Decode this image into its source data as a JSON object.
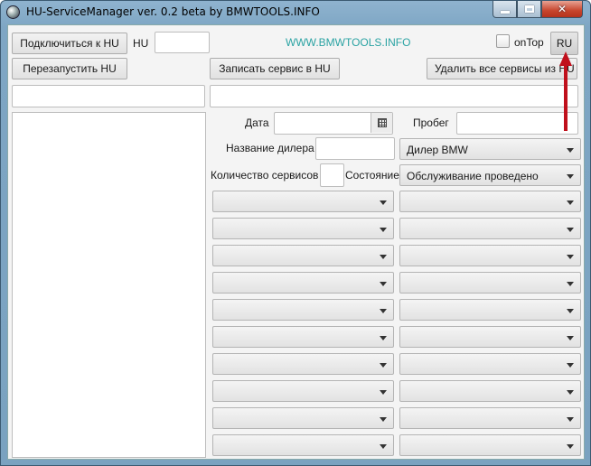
{
  "window": {
    "title": "HU-ServiceManager ver. 0.2 beta by BMWTOOLS.INFO"
  },
  "toolbar": {
    "connect_label": "Подключиться к HU",
    "hu_label": "HU",
    "hu_value": "",
    "site_link": "WWW.BMWTOOLS.INFO",
    "ontop_label": "onTop",
    "lang_label": "RU",
    "restart_label": "Перезапустить HU",
    "write_label": "Записать сервис в HU",
    "delete_label": "Удалить все сервисы из HU"
  },
  "form": {
    "date_label": "Дата",
    "date_value": "",
    "mileage_label": "Пробег",
    "mileage_value": "",
    "dealer_name_label": "Название дилера",
    "dealer_name_value": "",
    "dealer_select": "Дилер BMW",
    "count_label": "Количество сервисов",
    "count_value": "",
    "status_label": "Состояние",
    "status_select": "Обслуживание проведено"
  },
  "service_rows": [
    {
      "left": "",
      "right": ""
    },
    {
      "left": "",
      "right": ""
    },
    {
      "left": "",
      "right": ""
    },
    {
      "left": "",
      "right": ""
    },
    {
      "left": "",
      "right": ""
    },
    {
      "left": "",
      "right": ""
    },
    {
      "left": "",
      "right": ""
    },
    {
      "left": "",
      "right": ""
    },
    {
      "left": "",
      "right": ""
    },
    {
      "left": "",
      "right": ""
    }
  ],
  "colors": {
    "accent_link": "#2ba3a3",
    "annotation_arrow": "#c0101c"
  },
  "icons": {
    "calendar": "calendar-icon",
    "dropdown": "chevron-down-icon",
    "app": "app-icon"
  }
}
